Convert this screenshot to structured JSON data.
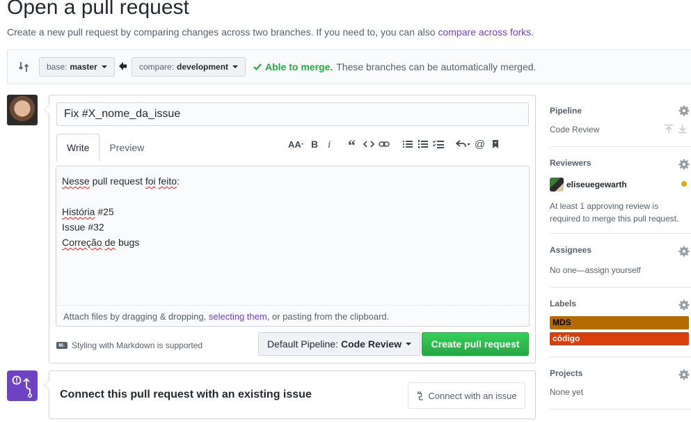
{
  "header": {
    "title": "Open a pull request",
    "subtitle_text": "Create a new pull request by comparing changes across two branches. If you need to, you can also",
    "subtitle_link": "compare across forks",
    "subtitle_end": "."
  },
  "range": {
    "base_label": "base:",
    "base_value": "master",
    "compare_label": "compare:",
    "compare_value": "development",
    "merge_ok": "Able to merge.",
    "merge_text": "These branches can be automatically merged."
  },
  "composer": {
    "title_value": "Fix #X_nome_da_issue",
    "tabs": [
      "Write",
      "Preview"
    ],
    "body_lines": [
      {
        "parts": [
          {
            "t": "Nesse",
            "sq": true
          },
          {
            "t": " pull request "
          },
          {
            "t": "foi",
            "sq": true
          },
          {
            "t": " "
          },
          {
            "t": "feito",
            "sq": true
          },
          {
            "t": ":"
          }
        ]
      },
      {
        "parts": [
          {
            "t": ""
          }
        ]
      },
      {
        "parts": [
          {
            "t": "História",
            "sq": true
          },
          {
            "t": " #25"
          }
        ]
      },
      {
        "parts": [
          {
            "t": "Issue #32"
          }
        ]
      },
      {
        "parts": [
          {
            "t": "Correção",
            "sq": true
          },
          {
            "t": " "
          },
          {
            "t": "de",
            "sq": true
          },
          {
            "t": " bugs"
          }
        ]
      }
    ],
    "attach_pre": "Attach files by dragging & dropping, ",
    "attach_link": "selecting them",
    "attach_post": ", or pasting from the clipboard.",
    "markdown_note": "Styling with Markdown is supported",
    "pipeline_label": "Default Pipeline:",
    "pipeline_value": "Code Review",
    "create_button": "Create pull request",
    "toolbar_icons": [
      "header-icon",
      "bold-icon",
      "italic-icon",
      "quote-icon",
      "code-icon",
      "link-icon",
      "unordered-list-icon",
      "ordered-list-icon",
      "task-list-icon",
      "reply-icon",
      "mention-icon",
      "bookmark-icon"
    ]
  },
  "connect": {
    "title": "Connect this pull request with an existing issue",
    "button": "Connect with an issue"
  },
  "sidebar": {
    "pipeline": {
      "heading": "Pipeline",
      "value": "Code Review"
    },
    "reviewers": {
      "heading": "Reviewers",
      "user": "eliseuegewarth",
      "note_line1": "At least 1 approving review is",
      "note_line2": "required to merge this pull request."
    },
    "assignees": {
      "heading": "Assignees",
      "value": "No one—assign yourself"
    },
    "labels": {
      "heading": "Labels",
      "items": [
        {
          "name": "MDS",
          "color": "#b36b00",
          "text_color": "#000000"
        },
        {
          "name": "código",
          "color": "#d93f0b",
          "text_color": "#ffffff"
        }
      ]
    },
    "projects": {
      "heading": "Projects",
      "value": "None yet"
    }
  },
  "colors": {
    "accent": "#6f42c1",
    "success": "#28a745",
    "pending": "#dbab09"
  }
}
